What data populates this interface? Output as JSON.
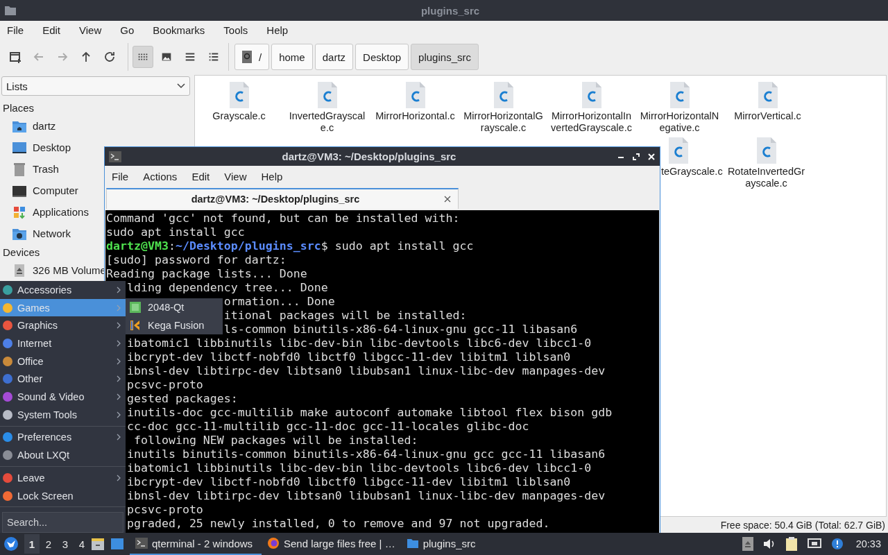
{
  "file_manager": {
    "title": "plugins_src",
    "menu": [
      "File",
      "Edit",
      "View",
      "Go",
      "Bookmarks",
      "Tools",
      "Help"
    ],
    "view_modes": [
      {
        "selected": true
      },
      {
        "selected": false
      },
      {
        "selected": false
      },
      {
        "selected": false
      }
    ],
    "path": [
      {
        "label": "/",
        "selected": false
      },
      {
        "label": "home",
        "selected": false
      },
      {
        "label": "dartz",
        "selected": false
      },
      {
        "label": "Desktop",
        "selected": false
      },
      {
        "label": "plugins_src",
        "selected": true
      }
    ],
    "sidebar": {
      "dropdown": "Lists",
      "sections": [
        {
          "heading": "Places",
          "items": [
            "dartz",
            "Desktop",
            "Trash",
            "Computer",
            "Applications",
            "Network"
          ]
        },
        {
          "heading": "Devices",
          "items": [
            "326 MB Volume"
          ]
        }
      ]
    },
    "files": [
      "Grayscale.c",
      "InvertedGrayscale.c",
      "MirrorHorizontal.c",
      "MirrorHorizontalGrayscale.c",
      "MirrorHorizontalInvertedGrayscale.c",
      "MirrorHorizontalNegative.c",
      "MirrorVertical.c"
    ],
    "files_row_2": [
      "teGrayscale.c",
      "RotateInvertedGrayscale.c"
    ],
    "status": "Free space: 50.4 GiB (Total: 62.7 GiB)"
  },
  "terminal": {
    "title": "dartz@VM3: ~/Desktop/plugins_src",
    "menu": [
      "File",
      "Actions",
      "Edit",
      "View",
      "Help"
    ],
    "tab": "dartz@VM3: ~/Desktop/plugins_src",
    "lines": [
      {
        "kind": "full",
        "text": "Command 'gcc' not found, but can be installed with:"
      },
      {
        "kind": "full",
        "text": "sudo apt install gcc"
      },
      {
        "kind": "prompt",
        "user": "dartz@VM3",
        "sep": ":",
        "cwd": "~/Desktop/plugins_src",
        "text": "$ sudo apt install gcc"
      },
      {
        "kind": "full",
        "text": "[sudo] password for dartz:"
      },
      {
        "kind": "full",
        "text": "Reading package lists... Done"
      },
      {
        "kind": "menu",
        "text": "lding dependency tree... Done"
      },
      {
        "kind": "submenu",
        "text": "ormation... Done"
      },
      {
        "kind": "submenu",
        "text": "itional packages will be installed:"
      },
      {
        "kind": "submenu",
        "text": "ls-common binutils-x86-64-linux-gnu gcc-11 libasan6"
      },
      {
        "kind": "menu",
        "text": "ibatomic1 libbinutils libc-dev-bin libc-devtools libc6-dev libcc1-0"
      },
      {
        "kind": "menu",
        "text": "ibcrypt-dev libctf-nobfd0 libctf0 libgcc-11-dev libitm1 liblsan0"
      },
      {
        "kind": "menu",
        "text": "ibnsl-dev libtirpc-dev libtsan0 libubsan1 linux-libc-dev manpages-dev"
      },
      {
        "kind": "menu",
        "text": "pcsvc-proto"
      },
      {
        "kind": "menu",
        "text": "gested packages:"
      },
      {
        "kind": "menu",
        "text": "inutils-doc gcc-multilib make autoconf automake libtool flex bison gdb"
      },
      {
        "kind": "menu",
        "text": "cc-doc gcc-11-multilib gcc-11-doc gcc-11-locales glibc-doc"
      },
      {
        "kind": "menu",
        "text": " following NEW packages will be installed:"
      },
      {
        "kind": "menu",
        "text": "inutils binutils-common binutils-x86-64-linux-gnu gcc gcc-11 libasan6"
      },
      {
        "kind": "menu",
        "text": "ibatomic1 libbinutils libc-dev-bin libc-devtools libc6-dev libcc1-0"
      },
      {
        "kind": "menu",
        "text": "ibcrypt-dev libctf-nobfd0 libctf0 libgcc-11-dev libitm1 liblsan0"
      },
      {
        "kind": "menu",
        "text": "ibnsl-dev libtirpc-dev libtsan0 libubsan1 linux-libc-dev manpages-dev"
      },
      {
        "kind": "menu",
        "text": "pcsvc-proto"
      },
      {
        "kind": "menu",
        "text": "pgraded, 25 newly installed, 0 to remove and 97 not upgraded."
      }
    ]
  },
  "start_menu": {
    "groups": [
      [
        {
          "label": "Accessories",
          "submenu": true,
          "selected": false
        },
        {
          "label": "Games",
          "submenu": true,
          "selected": true
        },
        {
          "label": "Graphics",
          "submenu": true,
          "selected": false
        },
        {
          "label": "Internet",
          "submenu": true,
          "selected": false
        },
        {
          "label": "Office",
          "submenu": true,
          "selected": false
        },
        {
          "label": "Other",
          "submenu": true,
          "selected": false
        },
        {
          "label": "Sound & Video",
          "submenu": true,
          "selected": false
        },
        {
          "label": "System Tools",
          "submenu": true,
          "selected": false
        }
      ],
      [
        {
          "label": "Preferences",
          "submenu": true,
          "selected": false
        },
        {
          "label": "About LXQt",
          "submenu": false,
          "selected": false
        }
      ],
      [
        {
          "label": "Leave",
          "submenu": true,
          "selected": false
        },
        {
          "label": "Lock Screen",
          "submenu": false,
          "selected": false
        }
      ]
    ],
    "search": {
      "placeholder": "Search..."
    },
    "submenu": [
      "2048-Qt",
      "Kega Fusion"
    ]
  },
  "taskbar": {
    "workspaces": [
      {
        "label": "1",
        "selected": true
      },
      {
        "label": "2",
        "selected": false
      },
      {
        "label": "3",
        "selected": false
      },
      {
        "label": "4",
        "selected": false
      }
    ],
    "tasks": [
      {
        "label": "qterminal - 2 windows",
        "selected": true
      },
      {
        "label": "Send large files free | …",
        "selected": false
      },
      {
        "label": "plugins_src",
        "selected": false
      }
    ],
    "clock": "20:33"
  }
}
